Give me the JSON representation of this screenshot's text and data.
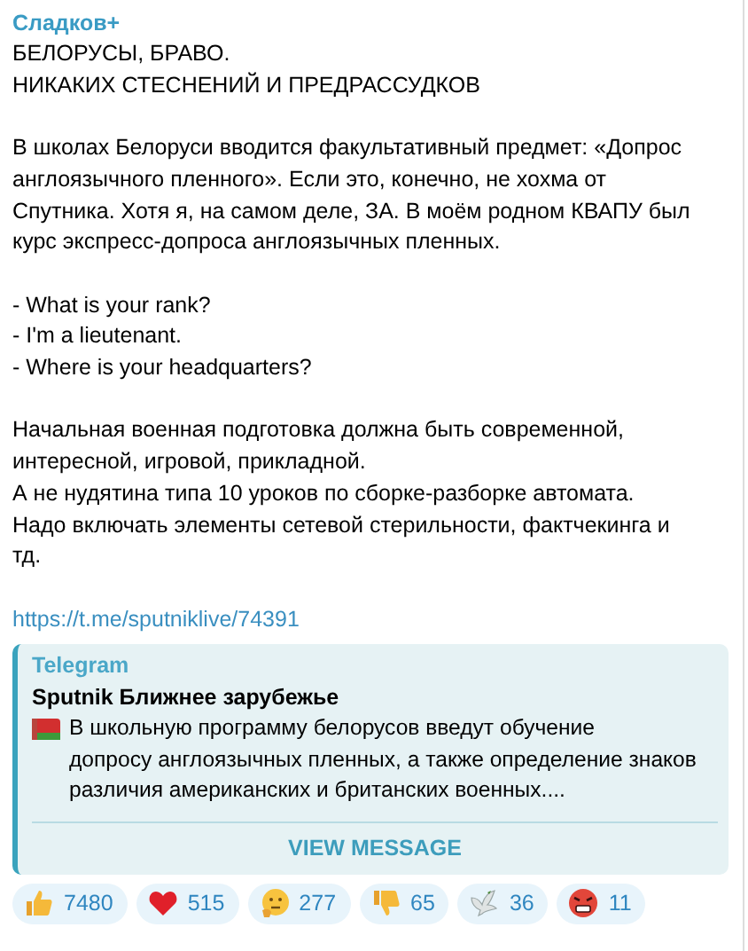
{
  "message": {
    "author": "Сладков+",
    "paragraphs": [
      "БЕЛОРУСЫ, БРАВО.\nНИКАКИХ СТЕСНЕНИЙ И ПРЕДРАССУДКОВ",
      "В школах Белоруси вводится факультативный предмет: «Допрос\nанглоязычного пленного». Если это, конечно, не хохма от\nСпутника. Хотя я, на самом деле, ЗА. В моём родном КВАПУ был\nкурс экспресс-допроса англоязычных пленных.",
      "- What is your rank?\n- I'm a lieutenant.\n- Where is your headquarters?",
      "Начальная военная подготовка должна быть современной,\nинтересной, игровой, прикладной.\nА не нудятина типа 10 уроков по сборке-разборке автомата.\nНадо включать элементы сетевой стерильности, фактчекинга и\nтд."
    ],
    "link": "https://t.me/sputniklive/74391",
    "preview": {
      "site": "Telegram",
      "title": "Sputnik Ближнее зарубежье",
      "text": "В школьную программу белорусов введут обучение\nдопросу англоязычных пленных, а также определение знаков\nразличия американских и британских военных....",
      "button": "VIEW MESSAGE"
    },
    "reactions": [
      {
        "kind": "thumbs-up",
        "count": "7480"
      },
      {
        "kind": "heart",
        "count": "515"
      },
      {
        "kind": "thinking",
        "count": "277"
      },
      {
        "kind": "thumbs-down",
        "count": "65"
      },
      {
        "kind": "dove",
        "count": "36"
      },
      {
        "kind": "angry",
        "count": "11"
      }
    ]
  }
}
